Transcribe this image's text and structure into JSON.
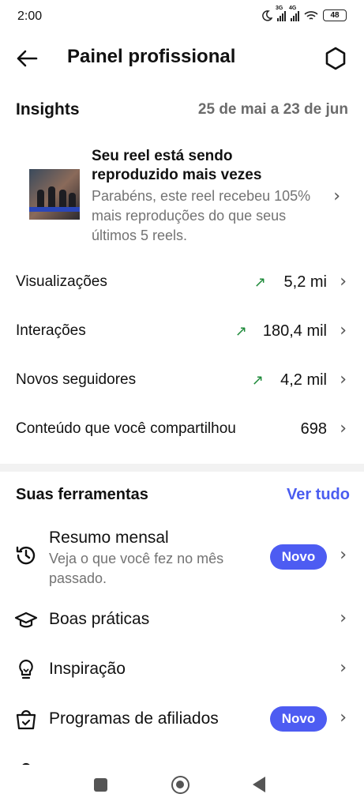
{
  "status": {
    "time": "2:00",
    "net1": "3G",
    "net2": "4G",
    "battery": "48"
  },
  "header": {
    "title": "Painel profissional"
  },
  "insights": {
    "title": "Insights",
    "date_range": "25 de mai a 23 de jun",
    "reel": {
      "headline": "Seu reel está sendo reproduzido mais vezes",
      "description": "Parabéns, este reel recebeu 105% mais reproduções do que seus últimos 5 reels."
    },
    "metrics": [
      {
        "label": "Visualizações",
        "value": "5,2 mi",
        "trend": "up"
      },
      {
        "label": "Interações",
        "value": "180,4 mil",
        "trend": "up"
      },
      {
        "label": "Novos seguidores",
        "value": "4,2 mil",
        "trend": "up"
      },
      {
        "label": "Conteúdo que você compartilhou",
        "value": "698",
        "trend": ""
      }
    ]
  },
  "tools": {
    "title": "Suas ferramentas",
    "see_all": "Ver tudo",
    "items": [
      {
        "label": "Resumo mensal",
        "sub": "Veja o que você fez no mês passado.",
        "badge": "Novo",
        "icon": "history-icon"
      },
      {
        "label": "Boas práticas",
        "icon": "graduation-cap-icon"
      },
      {
        "label": "Inspiração",
        "icon": "lightbulb-icon"
      },
      {
        "label": "Programas de afiliados",
        "badge": "Novo",
        "icon": "shopping-bag-icon"
      }
    ]
  },
  "colors": {
    "accent": "#4d5cf2",
    "trend_up": "#1e8a3a",
    "muted": "#737373"
  }
}
